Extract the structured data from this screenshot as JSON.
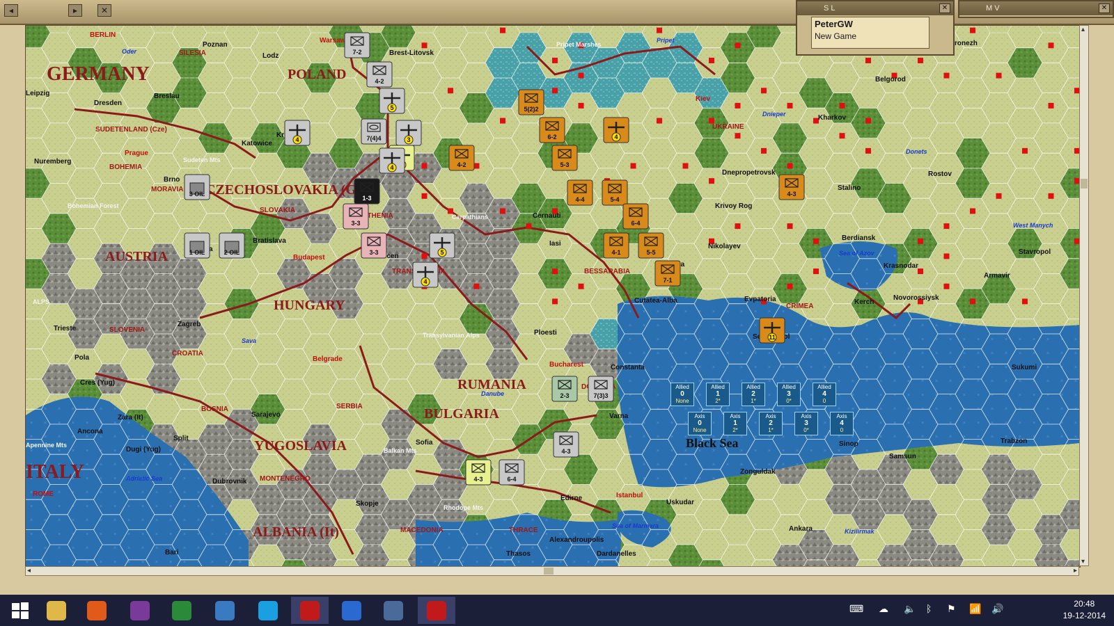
{
  "window": {
    "panel_sl_title": "S L",
    "panel_mv_title": "M V",
    "close_glyph": "✕",
    "player_name": "PeterGW",
    "game_status": "New Game"
  },
  "map": {
    "country_labels": [
      {
        "text": "GERMANY",
        "cls": "big"
      },
      {
        "text": "POLAND",
        "cls": "big2"
      },
      {
        "text": "CZECHOSLOVAKIA (G)",
        "cls": "big2"
      },
      {
        "text": "AUSTRIA",
        "cls": "big2"
      },
      {
        "text": "HUNGARY",
        "cls": "big2"
      },
      {
        "text": "RUMANIA",
        "cls": "big2"
      },
      {
        "text": "BULGARIA",
        "cls": "big2"
      },
      {
        "text": "YUGOSLAVIA",
        "cls": "big2"
      },
      {
        "text": "ITALY",
        "cls": "big"
      },
      {
        "text": "ALBANIA (It)",
        "cls": "big2"
      },
      {
        "text": "Black Sea",
        "cls": "sea"
      }
    ],
    "region_labels": [
      "SUDETENLAND (Cze)",
      "BOHEMIA",
      "MORAVIA",
      "SLOVAKIA",
      "RUTHENIA",
      "TRANSYLVANIA",
      "SILESIA",
      "UKRAINE",
      "BESSARABIA",
      "CRIMEA",
      "SLOVENIA",
      "CROATIA",
      "BOSNIA",
      "SERBIA",
      "MONTENEGRO",
      "MACEDONIA",
      "THRACE",
      "DOBRUJA"
    ],
    "city_labels": [
      "BERLIN",
      "Warsaw",
      "Brest-Litovsk",
      "Poznan",
      "Lodz",
      "Breslau",
      "Dresden",
      "Prague",
      "Katowice",
      "Krakow",
      "Nuremberg",
      "Brno",
      "Bratislava",
      "Vienna",
      "Budapest",
      "Debrecen",
      "Cernauti",
      "Iasi",
      "Odessa",
      "Nikolayev",
      "Kiev",
      "Kharkov",
      "Belgorod",
      "Voronezh",
      "Dnepropetrovsk",
      "Stalino",
      "Rostov",
      "Berdiansk",
      "Krasnodar",
      "Kerch",
      "Novorossiysk",
      "Stavropol",
      "Sevastopol",
      "Evpatoria",
      "Cutatea-Alba",
      "Krivoy Rog",
      "Constanta",
      "Varna",
      "Bucharest",
      "Ploesti",
      "Sofia",
      "Belgrade",
      "Zagreb",
      "Trieste",
      "Pola",
      "Sarajevo",
      "Split",
      "Ancona",
      "Dubrovnik",
      "Skopje",
      "Edirne",
      "Istanbul",
      "Uskudar",
      "Zonguldak",
      "Ankara",
      "Sinop",
      "Samsun",
      "Trabzon",
      "Sukumi",
      "Armavir",
      "ROME",
      "Bari",
      "Thasos",
      "Alexandroupolis",
      "Dardanelles",
      "Zara (It)",
      "Dugi (Yug)",
      "Cres (Yug)",
      "Leipzig"
    ],
    "terrain_labels": [
      "Pripet Marshes",
      "Pripet",
      "Sudeten Mts",
      "Bohemian Forest",
      "Carpathians",
      "Transylvanian Alps",
      "Balkan Mts",
      "Rhodope Mts",
      "ALPS",
      "Apennine Mts",
      "Adriatic Sea",
      "Sea of Azov",
      "Sea of Marmara",
      "Danube",
      "Dnieper",
      "Donets",
      "West Manych",
      "Oder",
      "Sava",
      "Kizilirmak"
    ]
  },
  "units": [
    {
      "label": "7-2",
      "type": "inf",
      "color": "#c8c8c8"
    },
    {
      "label": "4-2",
      "type": "inf",
      "color": "#c8c8c8"
    },
    {
      "label": "5(2)2",
      "type": "inf",
      "color": "#d88a1a"
    },
    {
      "label": "6-2",
      "type": "inf",
      "color": "#d88a1a"
    },
    {
      "label": "4",
      "type": "air",
      "color": "#d88a1a"
    },
    {
      "label": "4-2",
      "type": "inf",
      "color": "#d88a1a"
    },
    {
      "label": "5-3",
      "type": "inf",
      "color": "#d88a1a"
    },
    {
      "label": "4-4",
      "type": "inf",
      "color": "#d88a1a"
    },
    {
      "label": "5-4",
      "type": "inf",
      "color": "#d88a1a"
    },
    {
      "label": "4-3",
      "type": "inf",
      "color": "#d88a1a"
    },
    {
      "label": "6-4",
      "type": "inf",
      "color": "#d88a1a"
    },
    {
      "label": "4-1",
      "type": "inf",
      "color": "#d88a1a"
    },
    {
      "label": "5-5",
      "type": "inf",
      "color": "#d88a1a"
    },
    {
      "label": "7-1",
      "type": "inf",
      "color": "#d88a1a"
    },
    {
      "label": "1-3",
      "type": "inf",
      "color": "#1a1a1a"
    },
    {
      "label": "3-3",
      "type": "inf",
      "color": "#e8b4b8"
    },
    {
      "label": "3-3",
      "type": "inf",
      "color": "#e8b4b8"
    },
    {
      "label": "7(4)4",
      "type": "arm",
      "color": "#c8c8c8"
    },
    {
      "label": "2-3",
      "type": "inf",
      "color": "#a8c8a8"
    },
    {
      "label": "7(3)3",
      "type": "inf",
      "color": "#c8c8c8"
    },
    {
      "label": "4-3",
      "type": "inf",
      "color": "#c8c8c8"
    },
    {
      "label": "4-3",
      "type": "inf",
      "color": "#e8f090"
    },
    {
      "label": "6-4",
      "type": "inf",
      "color": "#c8c8c8"
    },
    {
      "label": "4",
      "type": "air",
      "color": "#c8c8c8"
    },
    {
      "label": "5",
      "type": "air",
      "color": "#c8c8c8"
    },
    {
      "label": "4",
      "type": "air",
      "color": "#e8f090"
    },
    {
      "label": "3",
      "type": "air",
      "color": "#c8c8c8"
    },
    {
      "label": "4",
      "type": "air",
      "color": "#c8c8c8"
    },
    {
      "label": "5",
      "type": "air",
      "color": "#c8c8c8"
    },
    {
      "label": "4",
      "type": "air",
      "color": "#c8c8c8"
    },
    {
      "label": "11",
      "type": "air",
      "color": "#d88a1a"
    },
    {
      "label": "3 OIL",
      "type": "oil",
      "color": "#c8c8c8"
    },
    {
      "label": "1 OIL",
      "type": "oil",
      "color": "#c8c8c8"
    },
    {
      "label": "2 OIL",
      "type": "oil",
      "color": "#c8c8c8"
    }
  ],
  "sea_boxes": {
    "allied": [
      {
        "title": "Allied",
        "num": "0",
        "sub": "None"
      },
      {
        "title": "Allied",
        "num": "1",
        "sub": "2*"
      },
      {
        "title": "Allied",
        "num": "2",
        "sub": "1*"
      },
      {
        "title": "Allied",
        "num": "3",
        "sub": "0*"
      },
      {
        "title": "Allied",
        "num": "4",
        "sub": "0"
      }
    ],
    "axis": [
      {
        "title": "Axis",
        "num": "0",
        "sub": "None"
      },
      {
        "title": "Axis",
        "num": "1",
        "sub": "2*"
      },
      {
        "title": "Axis",
        "num": "2",
        "sub": "1*"
      },
      {
        "title": "Axis",
        "num": "3",
        "sub": "0*"
      },
      {
        "title": "Axis",
        "num": "4",
        "sub": "0"
      }
    ]
  },
  "taskbar": {
    "clock_time": "20:48",
    "clock_date": "19-12-2014",
    "apps": [
      "start-icon",
      "file-explorer-icon",
      "media-player-icon",
      "colorful-app-icon",
      "chrome-icon",
      "thunderbird-icon",
      "skype-icon",
      "wif-game-icon",
      "mail-icon",
      "paint-icon",
      "wif-game-icon-2"
    ]
  },
  "colors": {
    "axis_border": "#8b1a1a",
    "soviet_marker": "#e01010",
    "sea": "#2a6fb0",
    "plains": "#c9cf8e",
    "forest": "#5c8f3a",
    "mountain": "#8a8a82"
  }
}
